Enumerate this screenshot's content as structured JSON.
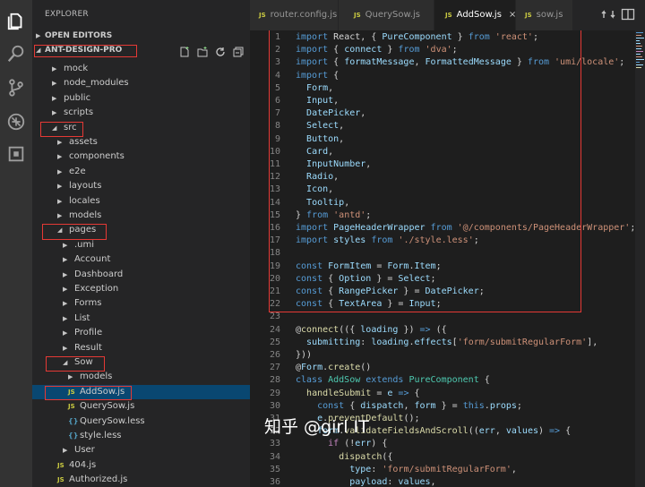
{
  "activity_bar": {
    "icons": [
      "files-icon",
      "search-icon",
      "source-control-icon",
      "debug-icon",
      "extensions-icon"
    ]
  },
  "sidebar": {
    "title": "EXPLORER",
    "open_editors": "OPEN EDITORS",
    "project": "ANT-DESIGN-PRO",
    "partial_top": "functions",
    "tree": [
      {
        "label": "mock",
        "kind": "folder"
      },
      {
        "label": "node_modules",
        "kind": "folder"
      },
      {
        "label": "public",
        "kind": "folder"
      },
      {
        "label": "scripts",
        "kind": "folder"
      },
      {
        "label": "src",
        "kind": "folder-open"
      },
      {
        "label": "assets",
        "kind": "folder"
      },
      {
        "label": "components",
        "kind": "folder"
      },
      {
        "label": "e2e",
        "kind": "folder"
      },
      {
        "label": "layouts",
        "kind": "folder"
      },
      {
        "label": "locales",
        "kind": "folder"
      },
      {
        "label": "models",
        "kind": "folder"
      },
      {
        "label": "pages",
        "kind": "folder-open"
      },
      {
        "label": ".umi",
        "kind": "folder"
      },
      {
        "label": "Account",
        "kind": "folder"
      },
      {
        "label": "Dashboard",
        "kind": "folder"
      },
      {
        "label": "Exception",
        "kind": "folder"
      },
      {
        "label": "Forms",
        "kind": "folder"
      },
      {
        "label": "List",
        "kind": "folder"
      },
      {
        "label": "Profile",
        "kind": "folder"
      },
      {
        "label": "Result",
        "kind": "folder"
      },
      {
        "label": "Sow",
        "kind": "folder-open"
      },
      {
        "label": "models",
        "kind": "folder"
      },
      {
        "label": "AddSow.js",
        "kind": "js",
        "icon": "JS"
      },
      {
        "label": "QuerySow.js",
        "kind": "js",
        "icon": "JS"
      },
      {
        "label": "QuerySow.less",
        "kind": "css",
        "icon": "{}"
      },
      {
        "label": "style.less",
        "kind": "css",
        "icon": "{}"
      },
      {
        "label": "User",
        "kind": "folder"
      },
      {
        "label": "404.js",
        "kind": "js",
        "icon": "JS"
      },
      {
        "label": "Authorized.js",
        "kind": "js",
        "icon": "JS"
      }
    ]
  },
  "tabs": [
    {
      "icon": "JS",
      "label": "router.config.js"
    },
    {
      "icon": "JS",
      "label": "QuerySow.js"
    },
    {
      "icon": "JS",
      "label": "AddSow.js",
      "close": "×",
      "active": true
    },
    {
      "icon": "JS",
      "label": "sow.js"
    }
  ],
  "editor": {
    "lines": [
      {
        "n": "1",
        "tokens": [
          [
            "kw",
            "import "
          ],
          [
            "op",
            "React, { "
          ],
          [
            "var",
            "PureComponent"
          ],
          [
            "op",
            " } "
          ],
          [
            "kw",
            "from "
          ],
          [
            "str",
            "'react'"
          ],
          [
            "op",
            ";"
          ]
        ]
      },
      {
        "n": "2",
        "tokens": [
          [
            "kw",
            "import "
          ],
          [
            "op",
            "{ "
          ],
          [
            "var",
            "connect"
          ],
          [
            "op",
            " } "
          ],
          [
            "kw",
            "from "
          ],
          [
            "str",
            "'dva'"
          ],
          [
            "op",
            ";"
          ]
        ]
      },
      {
        "n": "3",
        "tokens": [
          [
            "kw",
            "import "
          ],
          [
            "op",
            "{ "
          ],
          [
            "var",
            "formatMessage"
          ],
          [
            "op",
            ", "
          ],
          [
            "var",
            "FormattedMessage"
          ],
          [
            "op",
            " } "
          ],
          [
            "kw",
            "from "
          ],
          [
            "str",
            "'umi/locale'"
          ],
          [
            "op",
            ";"
          ]
        ]
      },
      {
        "n": "4",
        "tokens": [
          [
            "kw",
            "import "
          ],
          [
            "op",
            "{"
          ]
        ]
      },
      {
        "n": "5",
        "tokens": [
          [
            "op",
            "  "
          ],
          [
            "var",
            "Form"
          ],
          [
            "op",
            ","
          ]
        ]
      },
      {
        "n": "6",
        "tokens": [
          [
            "op",
            "  "
          ],
          [
            "var",
            "Input"
          ],
          [
            "op",
            ","
          ]
        ]
      },
      {
        "n": "7",
        "tokens": [
          [
            "op",
            "  "
          ],
          [
            "var",
            "DatePicker"
          ],
          [
            "op",
            ","
          ]
        ]
      },
      {
        "n": "8",
        "tokens": [
          [
            "op",
            "  "
          ],
          [
            "var",
            "Select"
          ],
          [
            "op",
            ","
          ]
        ]
      },
      {
        "n": "9",
        "tokens": [
          [
            "op",
            "  "
          ],
          [
            "var",
            "Button"
          ],
          [
            "op",
            ","
          ]
        ]
      },
      {
        "n": "10",
        "tokens": [
          [
            "op",
            "  "
          ],
          [
            "var",
            "Card"
          ],
          [
            "op",
            ","
          ]
        ]
      },
      {
        "n": "11",
        "tokens": [
          [
            "op",
            "  "
          ],
          [
            "var",
            "InputNumber"
          ],
          [
            "op",
            ","
          ]
        ]
      },
      {
        "n": "12",
        "tokens": [
          [
            "op",
            "  "
          ],
          [
            "var",
            "Radio"
          ],
          [
            "op",
            ","
          ]
        ]
      },
      {
        "n": "13",
        "tokens": [
          [
            "op",
            "  "
          ],
          [
            "var",
            "Icon"
          ],
          [
            "op",
            ","
          ]
        ]
      },
      {
        "n": "14",
        "tokens": [
          [
            "op",
            "  "
          ],
          [
            "var",
            "Tooltip"
          ],
          [
            "op",
            ","
          ]
        ]
      },
      {
        "n": "15",
        "tokens": [
          [
            "op",
            "} "
          ],
          [
            "kw",
            "from "
          ],
          [
            "str",
            "'antd'"
          ],
          [
            "op",
            ";"
          ]
        ]
      },
      {
        "n": "16",
        "tokens": [
          [
            "kw",
            "import "
          ],
          [
            "var",
            "PageHeaderWrapper"
          ],
          [
            "op",
            " "
          ],
          [
            "kw",
            "from "
          ],
          [
            "str",
            "'@/components/PageHeaderWrapper'"
          ],
          [
            "op",
            ";"
          ]
        ]
      },
      {
        "n": "17",
        "tokens": [
          [
            "kw",
            "import "
          ],
          [
            "var",
            "styles"
          ],
          [
            "op",
            " "
          ],
          [
            "kw",
            "from "
          ],
          [
            "str",
            "'./style.less'"
          ],
          [
            "op",
            ";"
          ]
        ]
      },
      {
        "n": "18",
        "tokens": []
      },
      {
        "n": "19",
        "tokens": [
          [
            "kw",
            "const "
          ],
          [
            "var",
            "FormItem"
          ],
          [
            "op",
            " = "
          ],
          [
            "var",
            "Form"
          ],
          [
            "op",
            "."
          ],
          [
            "var",
            "Item"
          ],
          [
            "op",
            ";"
          ]
        ]
      },
      {
        "n": "20",
        "tokens": [
          [
            "kw",
            "const "
          ],
          [
            "op",
            "{ "
          ],
          [
            "var",
            "Option"
          ],
          [
            "op",
            " } = "
          ],
          [
            "var",
            "Select"
          ],
          [
            "op",
            ";"
          ]
        ]
      },
      {
        "n": "21",
        "tokens": [
          [
            "kw",
            "const "
          ],
          [
            "op",
            "{ "
          ],
          [
            "var",
            "RangePicker"
          ],
          [
            "op",
            " } = "
          ],
          [
            "var",
            "DatePicker"
          ],
          [
            "op",
            ";"
          ]
        ]
      },
      {
        "n": "22",
        "tokens": [
          [
            "kw",
            "const "
          ],
          [
            "op",
            "{ "
          ],
          [
            "var",
            "TextArea"
          ],
          [
            "op",
            " } = "
          ],
          [
            "var",
            "Input"
          ],
          [
            "op",
            ";"
          ]
        ]
      },
      {
        "n": "23",
        "tokens": []
      },
      {
        "n": "24",
        "tokens": [
          [
            "op",
            "@"
          ],
          [
            "fn",
            "connect"
          ],
          [
            "op",
            "(({ "
          ],
          [
            "var",
            "loading"
          ],
          [
            "op",
            " }) "
          ],
          [
            "kw",
            "=>"
          ],
          [
            "op",
            " ({"
          ]
        ]
      },
      {
        "n": "25",
        "tokens": [
          [
            "op",
            "  "
          ],
          [
            "var",
            "submitting"
          ],
          [
            "op",
            ": "
          ],
          [
            "var",
            "loading"
          ],
          [
            "op",
            "."
          ],
          [
            "var",
            "effects"
          ],
          [
            "op",
            "["
          ],
          [
            "str",
            "'form/submitRegularForm'"
          ],
          [
            "op",
            "],"
          ]
        ]
      },
      {
        "n": "26",
        "tokens": [
          [
            "op",
            "}))"
          ]
        ]
      },
      {
        "n": "27",
        "tokens": [
          [
            "op",
            "@"
          ],
          [
            "var",
            "Form"
          ],
          [
            "op",
            "."
          ],
          [
            "fn",
            "create"
          ],
          [
            "op",
            "()"
          ]
        ]
      },
      {
        "n": "28",
        "tokens": [
          [
            "kw",
            "class "
          ],
          [
            "cls",
            "AddSow"
          ],
          [
            "op",
            " "
          ],
          [
            "kw",
            "extends "
          ],
          [
            "cls",
            "PureComponent"
          ],
          [
            "op",
            " {"
          ]
        ]
      },
      {
        "n": "29",
        "tokens": [
          [
            "op",
            "  "
          ],
          [
            "fn",
            "handleSubmit"
          ],
          [
            "op",
            " = "
          ],
          [
            "var",
            "e"
          ],
          [
            "op",
            " "
          ],
          [
            "kw",
            "=>"
          ],
          [
            "op",
            " {"
          ]
        ]
      },
      {
        "n": "30",
        "tokens": [
          [
            "op",
            "    "
          ],
          [
            "kw",
            "const "
          ],
          [
            "op",
            "{ "
          ],
          [
            "var",
            "dispatch"
          ],
          [
            "op",
            ", "
          ],
          [
            "var",
            "form"
          ],
          [
            "op",
            " } = "
          ],
          [
            "kw",
            "this"
          ],
          [
            "op",
            "."
          ],
          [
            "var",
            "props"
          ],
          [
            "op",
            ";"
          ]
        ]
      },
      {
        "n": "31",
        "tokens": [
          [
            "op",
            "    "
          ],
          [
            "var",
            "e"
          ],
          [
            "op",
            "."
          ],
          [
            "fn",
            "preventDefault"
          ],
          [
            "op",
            "();"
          ]
        ]
      },
      {
        "n": "32",
        "tokens": [
          [
            "op",
            "    "
          ],
          [
            "var",
            "form"
          ],
          [
            "op",
            "."
          ],
          [
            "fn",
            "validateFieldsAndScroll"
          ],
          [
            "op",
            "(("
          ],
          [
            "var",
            "err"
          ],
          [
            "op",
            ", "
          ],
          [
            "var",
            "values"
          ],
          [
            "op",
            ") "
          ],
          [
            "kw",
            "=>"
          ],
          [
            "op",
            " {"
          ]
        ]
      },
      {
        "n": "33",
        "tokens": [
          [
            "op",
            "      "
          ],
          [
            "ctl",
            "if "
          ],
          [
            "op",
            "(!"
          ],
          [
            "var",
            "err"
          ],
          [
            "op",
            ") {"
          ]
        ]
      },
      {
        "n": "34",
        "tokens": [
          [
            "op",
            "        "
          ],
          [
            "fn",
            "dispatch"
          ],
          [
            "op",
            "({"
          ]
        ]
      },
      {
        "n": "35",
        "tokens": [
          [
            "op",
            "          "
          ],
          [
            "var",
            "type"
          ],
          [
            "op",
            ": "
          ],
          [
            "str",
            "'form/submitRegularForm'"
          ],
          [
            "op",
            ","
          ]
        ]
      },
      {
        "n": "36",
        "tokens": [
          [
            "op",
            "          "
          ],
          [
            "var",
            "payload"
          ],
          [
            "op",
            ": "
          ],
          [
            "var",
            "values"
          ],
          [
            "op",
            ","
          ]
        ]
      }
    ]
  },
  "watermark": "知乎 @girl IT",
  "colors": {
    "highlight_box": "#e53935",
    "selection": "#094771"
  }
}
